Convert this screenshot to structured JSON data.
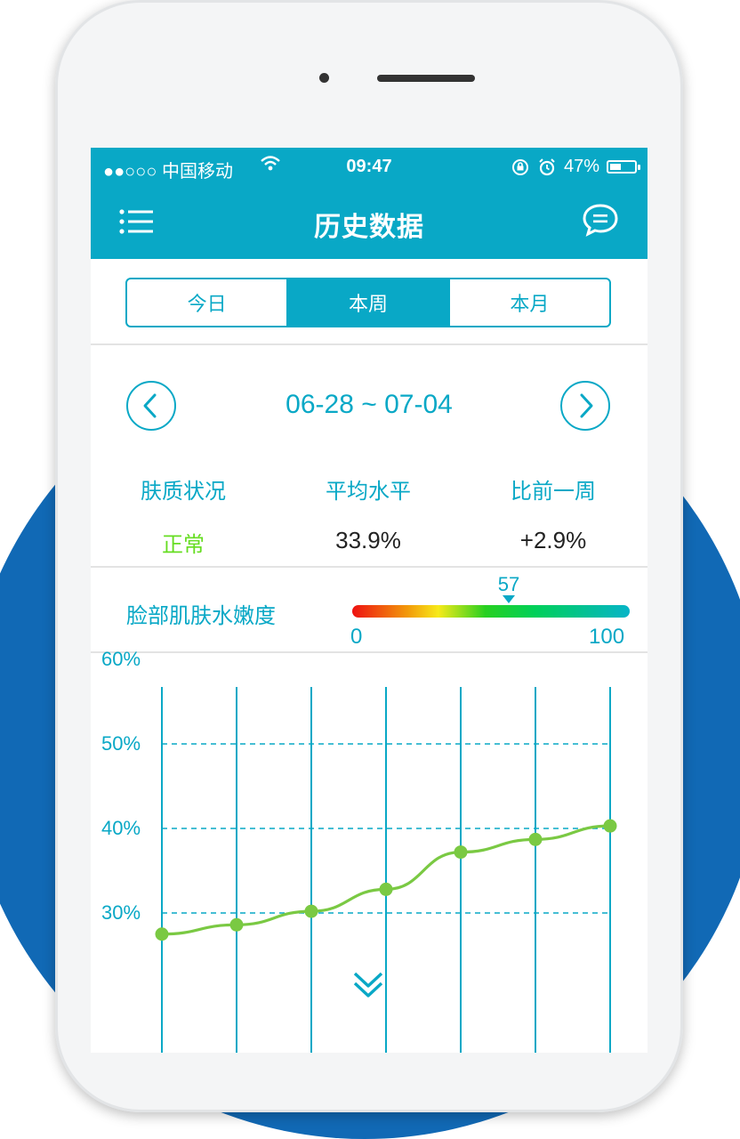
{
  "status_bar": {
    "carrier": "●●○○○ 中国移动",
    "time": "09:47",
    "battery": "47%",
    "battery_level": 0.47,
    "icons": [
      "wifi-icon",
      "orientation-lock-icon",
      "alarm-icon",
      "battery-icon"
    ]
  },
  "header": {
    "title": "历史数据",
    "left_icon": "menu-icon",
    "right_icon": "chat-icon"
  },
  "tabs": [
    {
      "label": "今日",
      "active": false
    },
    {
      "label": "本周",
      "active": true
    },
    {
      "label": "本月",
      "active": false
    }
  ],
  "date_nav": {
    "range": "06-28  ~   07-04",
    "prev_icon": "chevron-left-icon",
    "next_icon": "chevron-right-icon"
  },
  "stats": {
    "skin_status": {
      "label": "肤质状况",
      "value": "正常"
    },
    "average": {
      "label": "平均水平",
      "value": "33.9%"
    },
    "vs_last_week": {
      "label": "比前一周",
      "value": "+2.9%"
    }
  },
  "gauge": {
    "label": "脸部肌肤水嫩度",
    "value": "57",
    "min": "0",
    "max": "100"
  },
  "colors": {
    "accent": "#09a8c6",
    "line": "#7ac943",
    "normal_status": "#66dd22",
    "background_circle": "#1169b5"
  },
  "chart_data": {
    "type": "line",
    "title": "",
    "xlabel": "",
    "ylabel": "",
    "y_tick_labels": [
      "60%",
      "50%",
      "40%",
      "30%"
    ],
    "y_ticks": [
      60,
      50,
      40,
      30
    ],
    "ylim": [
      27,
      62
    ],
    "x": [
      1,
      2,
      3,
      4,
      5,
      6,
      7
    ],
    "series": [
      {
        "values": [
          27.5,
          28.6,
          30.2,
          32.8,
          37.2,
          38.7,
          40.3
        ]
      }
    ],
    "grid": {
      "horizontal": "dashed",
      "vertical": "solid"
    }
  },
  "footer": {
    "scroll_icon": "double-chevron-down-icon"
  }
}
